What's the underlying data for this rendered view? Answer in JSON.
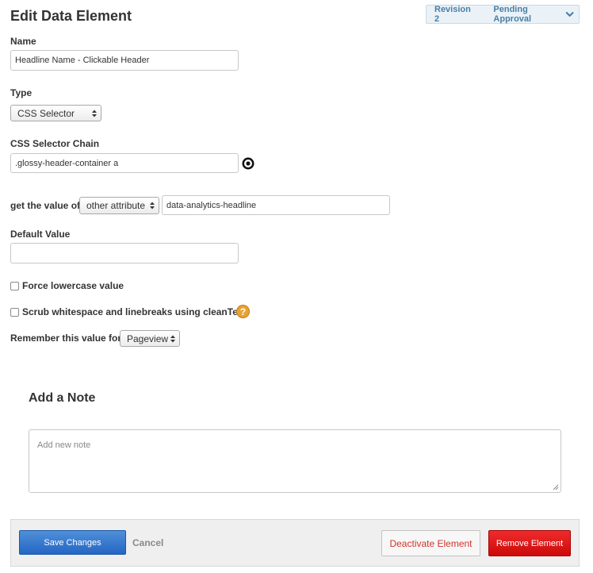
{
  "header": {
    "title": "Edit Data Element"
  },
  "revision": {
    "revision_label": "Revision 2",
    "status": "Pending Approval"
  },
  "form": {
    "name": {
      "label": "Name",
      "value": "Headline Name - Clickable Header"
    },
    "type": {
      "label": "Type",
      "selected": "CSS Selector"
    },
    "css_selector": {
      "label": "CSS Selector Chain",
      "value": ".glossy-header-container a"
    },
    "get_value": {
      "label": "get the value of",
      "selected": "other attribute",
      "attribute_value": "data-analytics-headline"
    },
    "default_value": {
      "label": "Default Value",
      "value": ""
    },
    "force_lowercase": {
      "label": "Force lowercase value",
      "checked": false
    },
    "scrub_whitespace": {
      "label": "Scrub whitespace and linebreaks using cleanText",
      "checked": false,
      "help": "?"
    },
    "remember": {
      "label": "Remember this value for",
      "selected": "Pageview"
    }
  },
  "note": {
    "title": "Add a Note",
    "placeholder": "Add new note"
  },
  "footer": {
    "save_label": "Save Changes",
    "cancel_label": "Cancel",
    "deactivate_label": "Deactivate Element",
    "remove_label": "Remove Element"
  },
  "icons": {
    "target": "target-icon",
    "chevron": "chevron-down-icon",
    "help": "help-icon",
    "select_arrows": "select-arrows-icon"
  },
  "colors": {
    "save_button": "#2e73cc",
    "remove_button": "#e01414",
    "deactivate_text": "#d0342c",
    "help_icon": "#e8a233",
    "revision_text": "#4a7fa5"
  }
}
